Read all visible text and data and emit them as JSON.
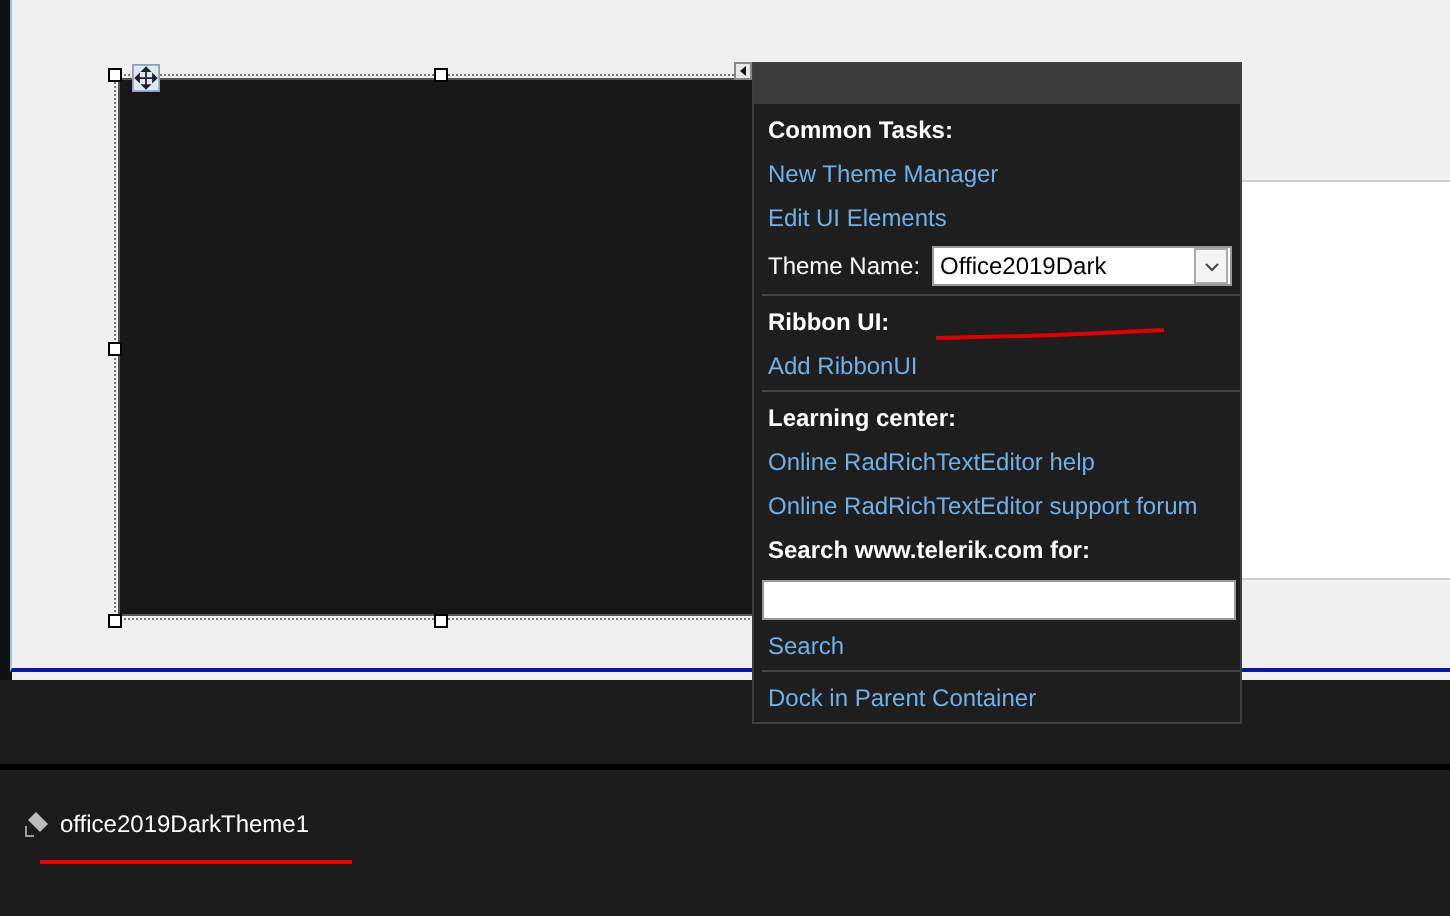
{
  "smart_tag_panel": {
    "sections": [
      {
        "heading": "Common Tasks:",
        "items": [
          {
            "kind": "link",
            "text": "New Theme Manager"
          },
          {
            "kind": "link",
            "text": "Edit UI Elements"
          },
          {
            "kind": "dropdown",
            "label": "Theme Name:",
            "value": "Office2019Dark"
          }
        ]
      },
      {
        "heading": "Ribbon UI:",
        "items": [
          {
            "kind": "link",
            "text": "Add RibbonUI"
          }
        ]
      },
      {
        "heading": "Learning center:",
        "items": [
          {
            "kind": "link",
            "text": "Online RadRichTextEditor help"
          },
          {
            "kind": "link",
            "text": "Online RadRichTextEditor support forum"
          },
          {
            "kind": "label",
            "text": "Search www.telerik.com for:"
          },
          {
            "kind": "input"
          },
          {
            "kind": "link",
            "text": "Search"
          }
        ]
      },
      {
        "items": [
          {
            "kind": "link",
            "text": "Dock in Parent Container"
          }
        ]
      }
    ]
  },
  "component_tray": {
    "items": [
      {
        "label": "office2019DarkTheme1"
      }
    ]
  }
}
